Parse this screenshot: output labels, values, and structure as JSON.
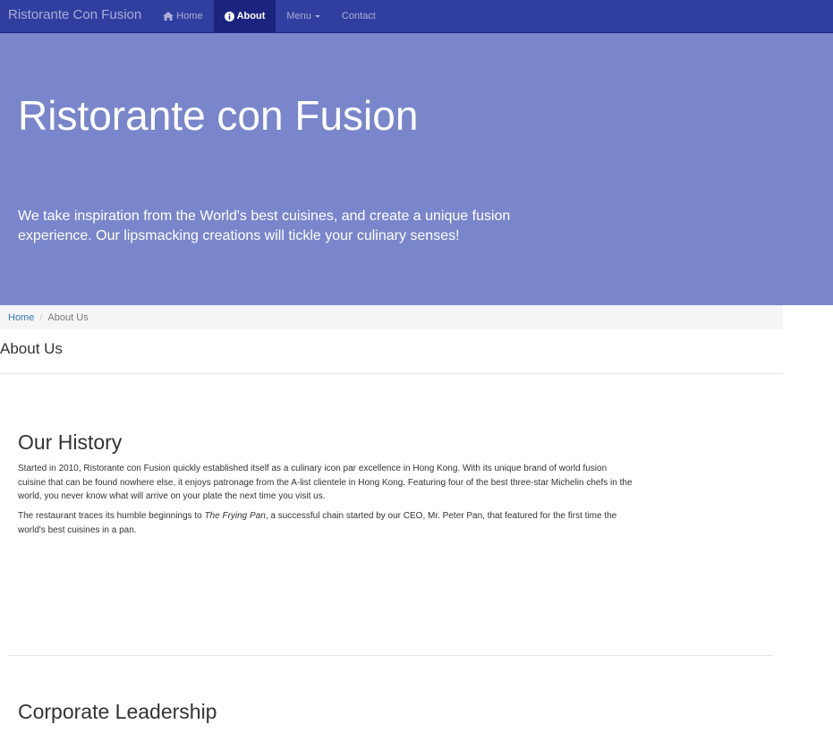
{
  "navbar": {
    "brand": "Ristorante Con Fusion",
    "items": [
      {
        "label": "Home",
        "icon": "home-icon"
      },
      {
        "label": "About",
        "icon": "info-circle-icon",
        "active": true
      },
      {
        "label": "Menu",
        "icon": "caret-down-icon"
      },
      {
        "label": "Contact"
      }
    ],
    "bg_color": "#303f9f",
    "active_color": "#1a237e"
  },
  "jumbotron": {
    "title": "Ristorante con Fusion",
    "text": "We take inspiration from the World's best cuisines, and create a unique fusion experience. Our lipsmacking creations will tickle your culinary senses!",
    "bg_color": "#7986cb"
  },
  "breadcrumb": {
    "home": "Home",
    "separator": "/",
    "current": "About Us"
  },
  "page": {
    "heading": "About Us"
  },
  "history": {
    "title": "Our History",
    "p1": "Started in 2010, Ristorante con Fusion quickly established itself as a culinary icon par excellence in Hong Kong. With its unique brand of world fusion cuisine that can be found nowhere else, it enjoys patronage from the A-list clientele in Hong Kong. Featuring four of the best three-star Michelin chefs in the world, you never know what will arrive on your plate the next time you visit us.",
    "p2_before": "The restaurant traces its humble beginnings to ",
    "p2_italic": "The Frying Pan",
    "p2_after": ", a successful chain started by our CEO, Mr. Peter Pan, that featured for the first time the world's best cuisines in a pan."
  },
  "leadership": {
    "title": "Corporate Leadership"
  }
}
